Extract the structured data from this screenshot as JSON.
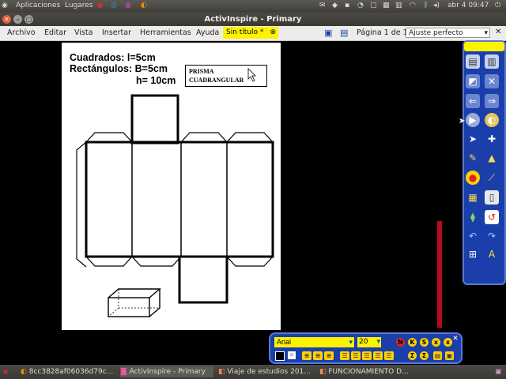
{
  "system_panel": {
    "apps_label": "Aplicaciones",
    "places_label": "Lugares",
    "clock": "abr 4 09:47"
  },
  "window": {
    "title": "ActivInspire - Primary"
  },
  "menubar": {
    "items": [
      "Archivo",
      "Editar",
      "Vista",
      "Insertar",
      "Herramientas",
      "Ayuda"
    ],
    "document_tab": "Sin título *",
    "page_info": "Página 1 de 1",
    "zoom": "Ajuste perfecto"
  },
  "flipchart": {
    "line1": "Cuadrados: l=5cm",
    "line2": "Rectángulos: B=5cm",
    "line3": "h= 10cm",
    "label_line1": "PRISMA",
    "label_line2": "CUADRANGULAR"
  },
  "text_toolbar": {
    "font": "Arial",
    "size": "20"
  },
  "taskbar": {
    "tasks": [
      "8cc3828af06036d79c...",
      "ActivInspire - Primary",
      "Viaje de estudios 201...",
      "FUNCIONAMIENTO D..."
    ]
  },
  "colors": {
    "brand_blue": "#1b3faa",
    "highlight_yellow": "#fef200",
    "panel_dark": "#3c3b37"
  }
}
